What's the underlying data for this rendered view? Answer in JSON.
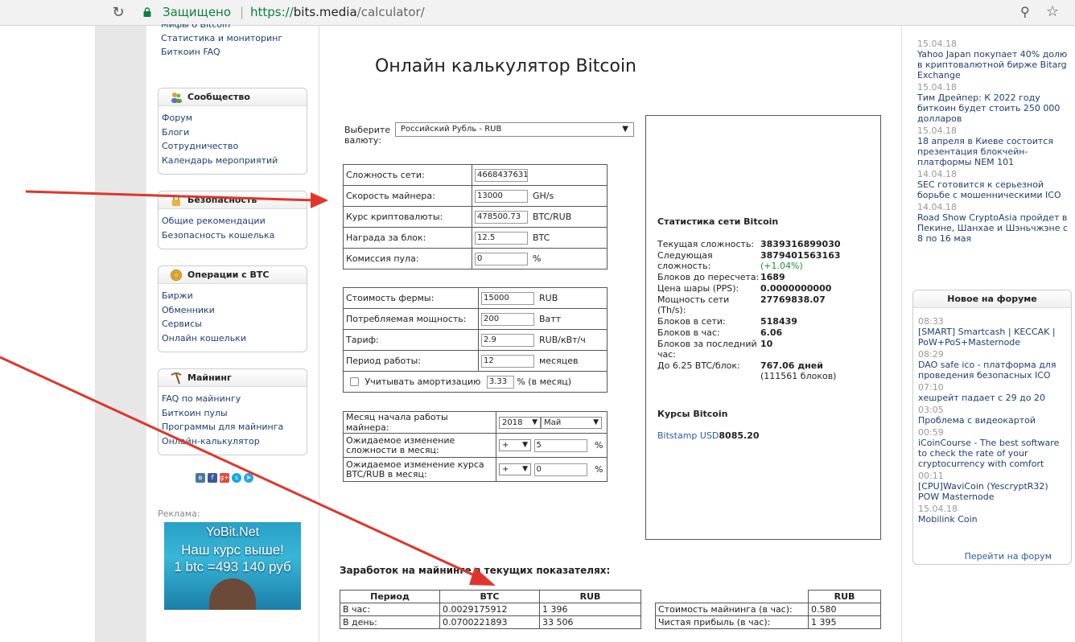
{
  "browser": {
    "secure_label": "Защищено",
    "url_scheme": "https://",
    "url_host": "bits.media",
    "url_path": "/calculator/"
  },
  "left_nav": {
    "top_items": [
      "Мифы о Bitcoin",
      "Статистика и мониторинг",
      "Биткоин FAQ"
    ],
    "boxes": [
      {
        "title": "Сообщество",
        "items": [
          "Форум",
          "Блоги",
          "Сотрудничество",
          "Календарь мероприятий"
        ]
      },
      {
        "title": "Безопасность",
        "items": [
          "Общие рекомендации",
          "Безопасность кошелька"
        ]
      },
      {
        "title": "Операции с BTC",
        "items": [
          "Биржи",
          "Обменники",
          "Сервисы",
          "Онлайн кошельки"
        ]
      },
      {
        "title": "Майнинг",
        "items": [
          "FAQ по майнингу",
          "Биткоин пулы",
          "Программы для майнинга",
          "Онлайн-калькулятор"
        ]
      }
    ],
    "ad_label": "Реклама:",
    "ad_lines": [
      "YoBit.Net",
      "Наш курс выше!",
      "1 btc =493 140 руб"
    ]
  },
  "main": {
    "title": "Онлайн калькулятор Bitcoin",
    "currency_label": "Выберите валюту:",
    "currency_value": "Российский Рубль - RUB",
    "table1": [
      {
        "label": "Сложность сети:",
        "value": "4668437631",
        "unit": ""
      },
      {
        "label": "Скорость майнера:",
        "value": "13000",
        "unit": "GH/s"
      },
      {
        "label": "Курс криптовалюты:",
        "value": "478500.73",
        "unit": "BTC/RUB"
      },
      {
        "label": "Награда за блок:",
        "value": "12.5",
        "unit": "BTC"
      },
      {
        "label": "Комиссия пула:",
        "value": "0",
        "unit": "%"
      }
    ],
    "table2": [
      {
        "label": "Стоимость фермы:",
        "value": "15000",
        "unit": "RUB"
      },
      {
        "label": "Потребляемая мощность:",
        "value": "200",
        "unit": "Ватт"
      },
      {
        "label": "Тариф:",
        "value": "2.9",
        "unit": "RUB/кВт/ч"
      },
      {
        "label": "Период работы:",
        "value": "12",
        "unit": "месяцев"
      }
    ],
    "amort_label": "Учитывать амортизацию",
    "amort_value": "3.33",
    "amort_unit": "% (в месяц)",
    "table3": {
      "start_label": "Месяц начала работы майнера:",
      "start_year": "2018",
      "start_month": "Май",
      "diff_label": "Ожидаемое изменение сложности в месяц:",
      "diff_sign": "+",
      "diff_value": "5",
      "rate_label": "Ожидаемое изменение курса BTC/RUB в месяц:",
      "rate_sign": "+",
      "rate_value": "0",
      "pct": "%"
    },
    "earn_title": "Заработок на майнинге в текущих показателях:",
    "earn_headers": [
      "Период",
      "BTC",
      "RUB"
    ],
    "earn_rows": [
      [
        "В час:",
        "0.0029175912",
        "1 396"
      ],
      [
        "В день:",
        "0.0700221893",
        "33 506"
      ]
    ],
    "cost_header": "RUB",
    "cost_rows": [
      [
        "Стоимость майнинга (в час):",
        "0.580"
      ],
      [
        "Чистая прибыль (в час):",
        "1 395"
      ]
    ]
  },
  "stats": {
    "title": "Статистика сети Bitcoin",
    "rows": [
      {
        "label": "Текущая сложность:",
        "value": "3839316899030",
        "extra": ""
      },
      {
        "label": "Следующая сложность:",
        "value": "3879401563163",
        "extra": "(+1.04%)"
      },
      {
        "label": "Блоков до пересчета:",
        "value": "1689",
        "extra": ""
      },
      {
        "label": "Цена шары (PPS):",
        "value": "0.0000000000",
        "extra": ""
      },
      {
        "label": "Мощность сети (Th/s):",
        "value": "27769838.07",
        "extra": ""
      },
      {
        "label": "Блоков в сети:",
        "value": "518439",
        "extra": ""
      },
      {
        "label": "Блоков в час:",
        "value": "6.06",
        "extra": ""
      },
      {
        "label": "Блоков за последний час:",
        "value": "10",
        "extra": ""
      },
      {
        "label": "До 6.25 BTC/блок:",
        "value": "767.06 дней",
        "extra": "(111561 блоков)"
      }
    ],
    "rates_title": "Курсы Bitcoin",
    "rates_source": "Bitstamp USD",
    "rates_value": "8085.20"
  },
  "news": [
    {
      "date": "15.04.18",
      "title": "Yahoo Japan покупает 40% долю в криптовалютной бирже Bitarg Exchange"
    },
    {
      "date": "15.04.18",
      "title": "Тим Дрейпер: К 2022 году биткоин будет стоить 250 000 долларов"
    },
    {
      "date": "15.04.18",
      "title": "18 апреля в Киеве состоится презентация блокчейн-платформы NEM 101"
    },
    {
      "date": "14.04.18",
      "title": "SEC готовится к серьезной борьбе с мошенническими ICO"
    },
    {
      "date": "14.04.18",
      "title": "Road Show CryptoAsia пройдет в Пекине, Шанхае и Шэньчжэне с 8 по 16 мая"
    }
  ],
  "forum": {
    "title": "Новое на форуме",
    "items": [
      {
        "time": "08:33",
        "title": "[SMART] Smartcash | KECCAK | PoW+PoS+Masternode"
      },
      {
        "time": "08:29",
        "title": "DAO safe ico - платформа для проведения безопасных ICO"
      },
      {
        "time": "07:10",
        "title": "хешрейт падает с 29 до 20"
      },
      {
        "time": "03:05",
        "title": "Проблема с видеокартой"
      },
      {
        "time": "00:59",
        "title": "iCoinCourse - The best software to check the rate of your cryptocurrency with comfort"
      },
      {
        "time": "00:11",
        "title": "[CPU]WaviCoin (YescryptR32) POW Masternode"
      },
      {
        "time": "15.04.18",
        "title": "Mobilink Coin"
      }
    ],
    "more": "Перейти на форум"
  },
  "colors": {
    "secure_green": "#0b8043",
    "link": "#1f3e6e",
    "arrow_red": "#e0352b"
  }
}
